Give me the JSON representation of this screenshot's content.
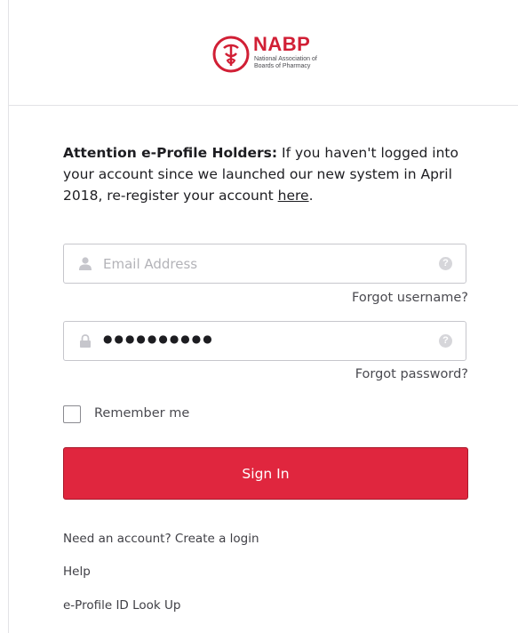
{
  "brand": {
    "name": "NABP",
    "subtitle_lines": [
      "National Association of",
      "Boards of Pharmacy"
    ],
    "accent_color": "#d11f35"
  },
  "notice": {
    "heading": "Attention e-Profile Holders:",
    "body": " If you haven't logged into your account since we launched our new system in April 2018, re-register your account ",
    "link_label": "here",
    "trailing": "."
  },
  "username": {
    "placeholder": "Email Address",
    "value": "",
    "icon": "user-icon",
    "help_glyph": "?",
    "forgot_label": "Forgot username?"
  },
  "password": {
    "masked_value": "●●●●●●●●●●",
    "icon": "lock-icon",
    "help_glyph": "?",
    "forgot_label": "Forgot password?"
  },
  "remember": {
    "label": "Remember me",
    "checked": false
  },
  "submit": {
    "label": "Sign In",
    "color": "#e0263e"
  },
  "footer_links": {
    "create": "Need an account? Create a login",
    "help": "Help",
    "lookup": "e-Profile ID Look Up"
  }
}
